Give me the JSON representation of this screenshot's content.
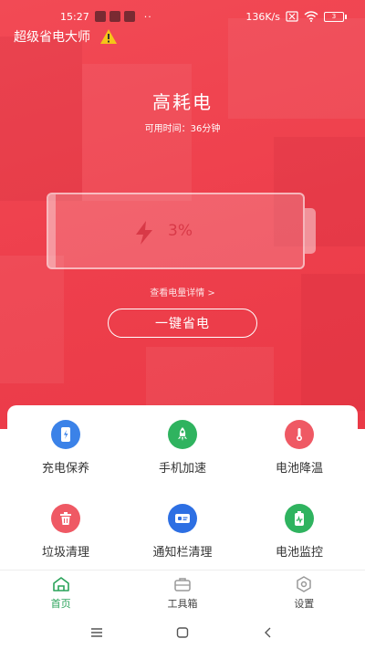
{
  "status_bar": {
    "time": "15:27",
    "notification_dots": "··",
    "net_speed": "136K/s",
    "battery_level": "3"
  },
  "app": {
    "title": "超级省电大师"
  },
  "hero": {
    "headline": "高耗电",
    "available_time": "可用时间：36分钟",
    "battery_percent_text": "3%",
    "battery_fraction": 0.03,
    "details_link": "查看电量详情 >",
    "one_tap_save": "一键省电"
  },
  "tools": [
    {
      "label": "充电保养",
      "icon": "phone-charge-icon",
      "color": "#3b82e8"
    },
    {
      "label": "手机加速",
      "icon": "rocket-icon",
      "color": "#2fb35f"
    },
    {
      "label": "电池降温",
      "icon": "thermometer-icon",
      "color": "#ef5964"
    },
    {
      "label": "垃圾清理",
      "icon": "trash-icon",
      "color": "#ef5964"
    },
    {
      "label": "通知栏清理",
      "icon": "notification-card-icon",
      "color": "#2d6fe3"
    },
    {
      "label": "电池监控",
      "icon": "battery-monitor-icon",
      "color": "#2fb35f"
    }
  ],
  "tabs": [
    {
      "label": "首页",
      "icon": "home-icon",
      "active": true
    },
    {
      "label": "工具箱",
      "icon": "toolbox-icon",
      "active": false
    },
    {
      "label": "设置",
      "icon": "settings-icon",
      "active": false
    }
  ],
  "colors": {
    "primary_red": "#ef4350",
    "accent_green": "#2aa35a"
  }
}
